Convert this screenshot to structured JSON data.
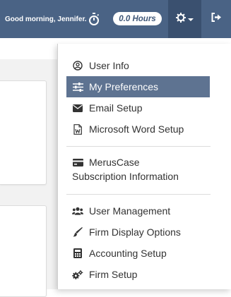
{
  "topbar": {
    "greeting": "Good morning, Jennifer.",
    "hours": "0.0 Hours"
  },
  "menu": {
    "user_info": "User Info",
    "my_preferences": "My Preferences",
    "email_setup": "Email Setup",
    "word_setup": "Microsoft Word Setup",
    "subscription_line1": "MerusCase",
    "subscription_line2": "Subscription Information",
    "user_management": "User Management",
    "firm_display_options": "Firm Display Options",
    "accounting_setup": "Accounting Setup",
    "firm_setup": "Firm Setup"
  },
  "colors": {
    "topbar": "#4a6385",
    "active_item": "#5e7391"
  },
  "icons": [
    "stopwatch-icon",
    "gear-icon",
    "caret-down-icon",
    "sign-out-icon",
    "user-circle-icon",
    "sliders-icon",
    "envelope-icon",
    "word-file-icon",
    "credit-card-icon",
    "users-icon",
    "paintbrush-icon",
    "calculator-icon",
    "cogs-icon"
  ]
}
